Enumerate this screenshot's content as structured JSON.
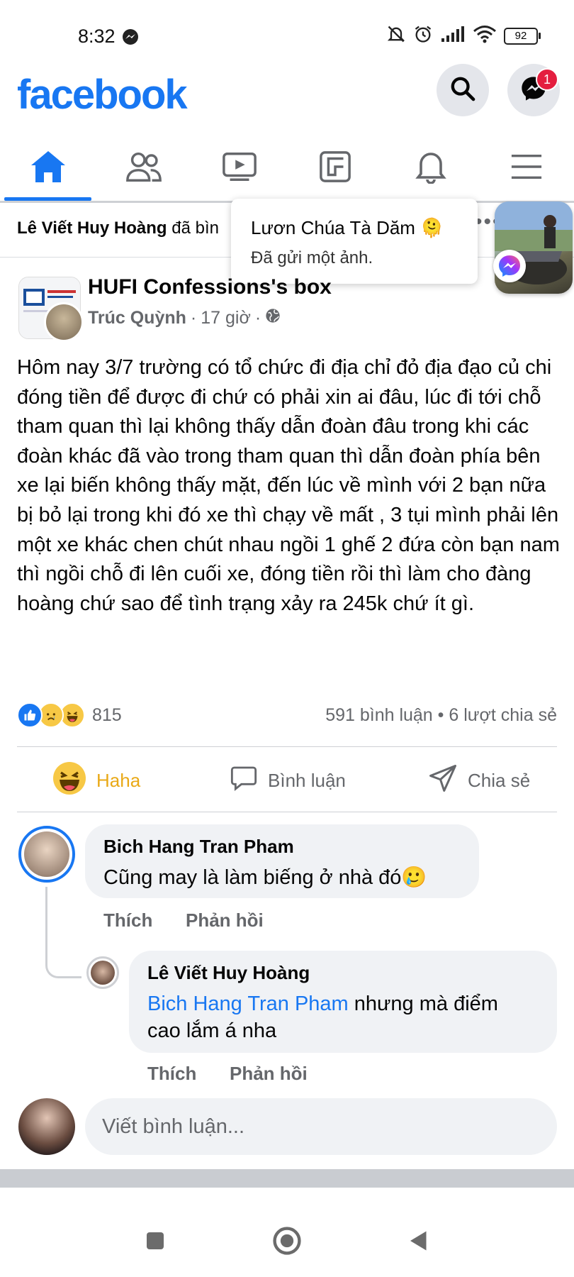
{
  "status_bar": {
    "time": "8:32",
    "battery": "92"
  },
  "header": {
    "logo": "facebook",
    "messenger_badge": "1"
  },
  "nav_tabs": [
    "home",
    "friends",
    "watch",
    "marketplace",
    "notifications",
    "menu"
  ],
  "activity": {
    "name": "Lê Viết Huy Hoàng",
    "action": "đã bìn"
  },
  "chat_popup": {
    "sender": "Lươn Chúa Tà Dăm 🫠",
    "message": "Đã gửi một ảnh."
  },
  "post": {
    "group_name": "HUFI Confessions's box",
    "author": "Trúc Quỳnh",
    "time": "17 giờ",
    "separator": "·",
    "text": "Hôm nay 3/7 trường có tổ chức đi địa chỉ đỏ địa đạo củ chi đóng tiền để được đi chứ có phải xin ai đâu, lúc đi tới chỗ tham quan thì lại không thấy dẫn đoàn đâu trong khi các đoàn khác đã vào trong tham quan thì dẫn đoàn phía bên xe lại biến không thấy mặt, đến lúc về mình với 2 bạn nữa bị bỏ lại trong khi đó xe thì chạy về mất , 3 tụi mình phải lên một xe khác chen chút nhau ngồi 1 ghế 2 đứa còn bạn nam thì ngồi chỗ đi lên cuối xe, đóng tiền rồi thì làm cho đàng hoàng chứ sao để tình trạng xảy ra 245k chứ ít gì.",
    "reaction_count": "815",
    "comments_shares": "591 bình luận • 6 lượt chia sẻ"
  },
  "actions": {
    "haha": "Haha",
    "comment": "Bình luận",
    "share": "Chia sẻ"
  },
  "comments": [
    {
      "name": "Bich Hang Tran Pham",
      "text": "Cũng may là làm biếng ở nhà đó🥲",
      "like": "Thích",
      "reply": "Phản hồi"
    },
    {
      "name": "Lê Viết Huy Hoàng",
      "mention": "Bich Hang Tran Pham",
      "text": " nhưng mà điểm cao lắm á nha",
      "like": "Thích",
      "reply": "Phản hồi"
    }
  ],
  "composer": {
    "placeholder": "Viết bình luận..."
  },
  "colors": {
    "brand": "#1877f2",
    "haha": "#e9a917",
    "badge": "#e41e3f"
  }
}
